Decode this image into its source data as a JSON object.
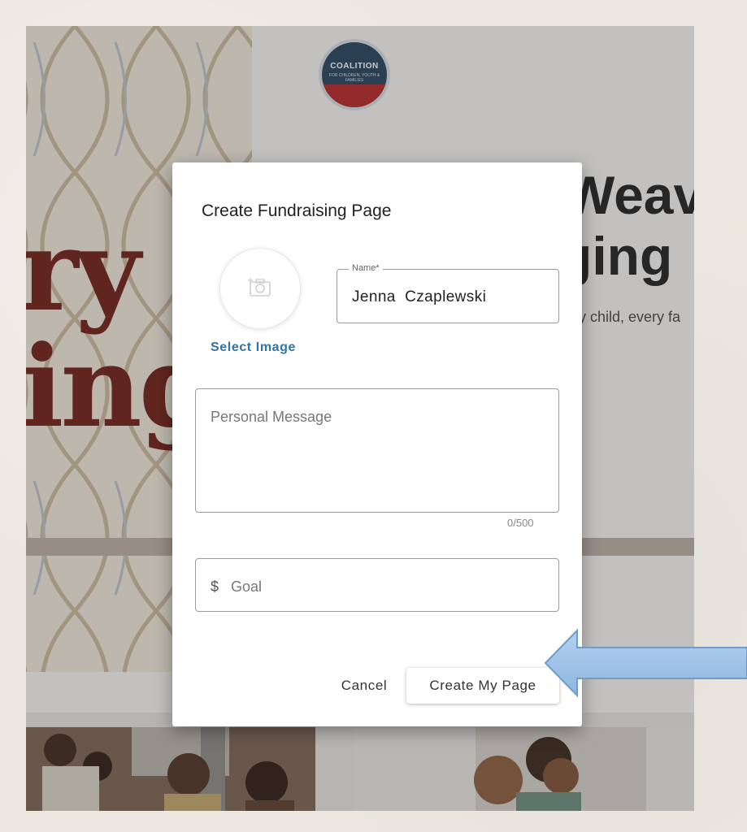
{
  "background": {
    "headline_line1": "Weav",
    "headline_line2": "ging",
    "subline": "ery child, every fa",
    "left_word_line1": "ry",
    "left_word_line2": "ing",
    "logo_title": "COALITION",
    "logo_subtitle": "FOR CHILDREN, YOUTH & FAMILIES"
  },
  "modal": {
    "title": "Create Fundraising Page",
    "select_image_label": "Select Image",
    "camera_icon": "camera-icon",
    "name_label": "Name*",
    "name_value": "Jenna  Czaplewski",
    "personal_message_placeholder": "Personal Message",
    "message_counter": "0/500",
    "goal_currency": "$",
    "goal_placeholder": "Goal",
    "cancel_label": "Cancel",
    "create_label": "Create My Page"
  },
  "annotation": {
    "arrow_icon": "left-arrow-icon",
    "arrow_color": "#9dc3e6"
  },
  "colors": {
    "accent_link": "#2f73a8",
    "brand_dark_red": "#6e1c14",
    "logo_navy": "#25405c",
    "logo_red": "#b52428"
  }
}
